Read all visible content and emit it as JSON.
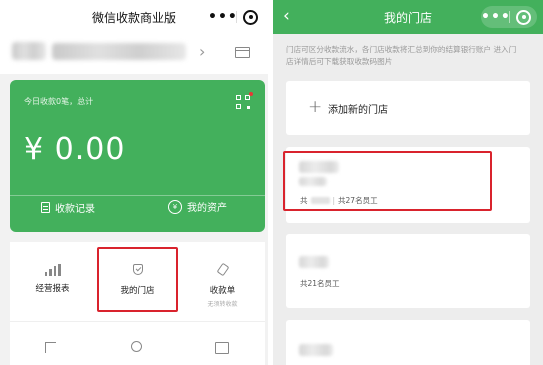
{
  "left": {
    "nav": {
      "title": "微信收款商业版",
      "more_glyph": "•••"
    },
    "card": {
      "subtitle": "今日收款0笔，总计",
      "amount": "¥ 0.00",
      "links": [
        {
          "label": "收款记录",
          "icon": "document-icon"
        },
        {
          "label": "我的资产",
          "icon": "yen-circle-icon"
        }
      ]
    },
    "grid": [
      {
        "label": "经营报表",
        "icon": "bar-chart-icon",
        "sub": ""
      },
      {
        "label": "我的门店",
        "icon": "store-check-icon",
        "sub": ""
      },
      {
        "label": "收款单",
        "icon": "tag-icon",
        "sub": "无须转收款"
      }
    ]
  },
  "right": {
    "nav": {
      "title": "我的门店",
      "back_glyph": "‹",
      "more_glyph": "•••"
    },
    "notice": "门店可区分收款流水，各门店收款将汇总到你的结算银行账户 进入门店详情后可下载获取收款码图片",
    "add_store": {
      "label": "添加新的门店",
      "glyph": "+"
    },
    "stores": [
      {
        "status_prefix": "共",
        "employee_count": "共27名员工"
      },
      {
        "status_prefix": "",
        "employee_count": "共21名员工"
      }
    ]
  },
  "colors": {
    "brand_green": "#43b05c",
    "highlight_red": "#d9232d"
  }
}
